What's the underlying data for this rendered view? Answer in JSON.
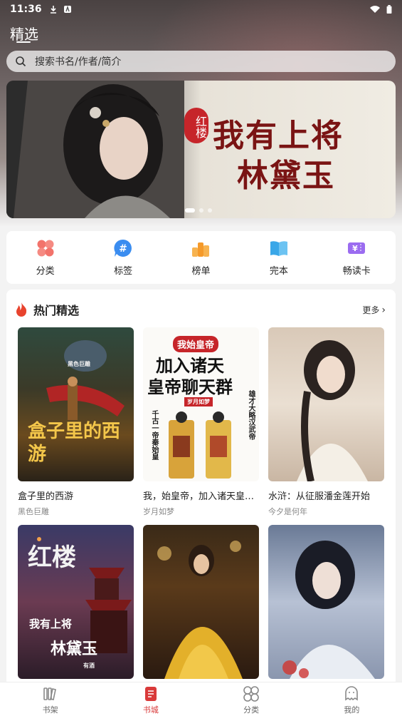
{
  "status_bar": {
    "time": "11:36"
  },
  "header": {
    "title": "精选"
  },
  "search": {
    "placeholder": "搜索书名/作者/简介"
  },
  "banner": {
    "seal": "红楼",
    "title_line1": "我有上将",
    "title_line2": "林黛玉"
  },
  "quick_nav": [
    {
      "label": "分类",
      "icon": "grid-icon",
      "color": "#f2736b"
    },
    {
      "label": "标签",
      "icon": "hashtag-icon",
      "color": "#3b8df0"
    },
    {
      "label": "榜单",
      "icon": "ranking-icon",
      "color": "#f59a2a"
    },
    {
      "label": "完本",
      "icon": "open-book-icon",
      "color": "#3aa7e8"
    },
    {
      "label": "畅读卡",
      "icon": "ticket-icon",
      "color": "#9b6cf0"
    }
  ],
  "hot": {
    "title": "热门精选",
    "more": "更多",
    "books": [
      {
        "title": "盒子里的西游",
        "author": "黑色巨雕",
        "cover_text": "盒子里的西游",
        "cover_author": "黑色巨雕"
      },
      {
        "title": "我，始皇帝，加入诸天皇帝聊天群",
        "author": "岁月如梦",
        "cover_badge": "我始皇帝",
        "cover_line1": "加入诸天",
        "cover_line2": "皇帝聊天群",
        "cover_author": "岁月如梦",
        "cover_left": "千古一帝秦始皇",
        "cover_right": "雄才大略汉武帝"
      },
      {
        "title": "水浒：从征服潘金莲开始",
        "author": "今夕是何年"
      },
      {
        "title": "",
        "author": "",
        "cover_line1": "红楼",
        "cover_line2": "我有上将",
        "cover_line3": "林黛玉",
        "cover_author": "有酒"
      },
      {
        "title": "",
        "author": ""
      },
      {
        "title": "",
        "author": ""
      }
    ]
  },
  "tabs": [
    {
      "label": "书架",
      "icon": "bookshelf-icon"
    },
    {
      "label": "书城",
      "icon": "bookstore-icon",
      "active": true
    },
    {
      "label": "分类",
      "icon": "category-icon"
    },
    {
      "label": "我的",
      "icon": "profile-icon"
    }
  ],
  "colors": {
    "accent": "#d93a3a",
    "banner_title": "#7a1414"
  }
}
